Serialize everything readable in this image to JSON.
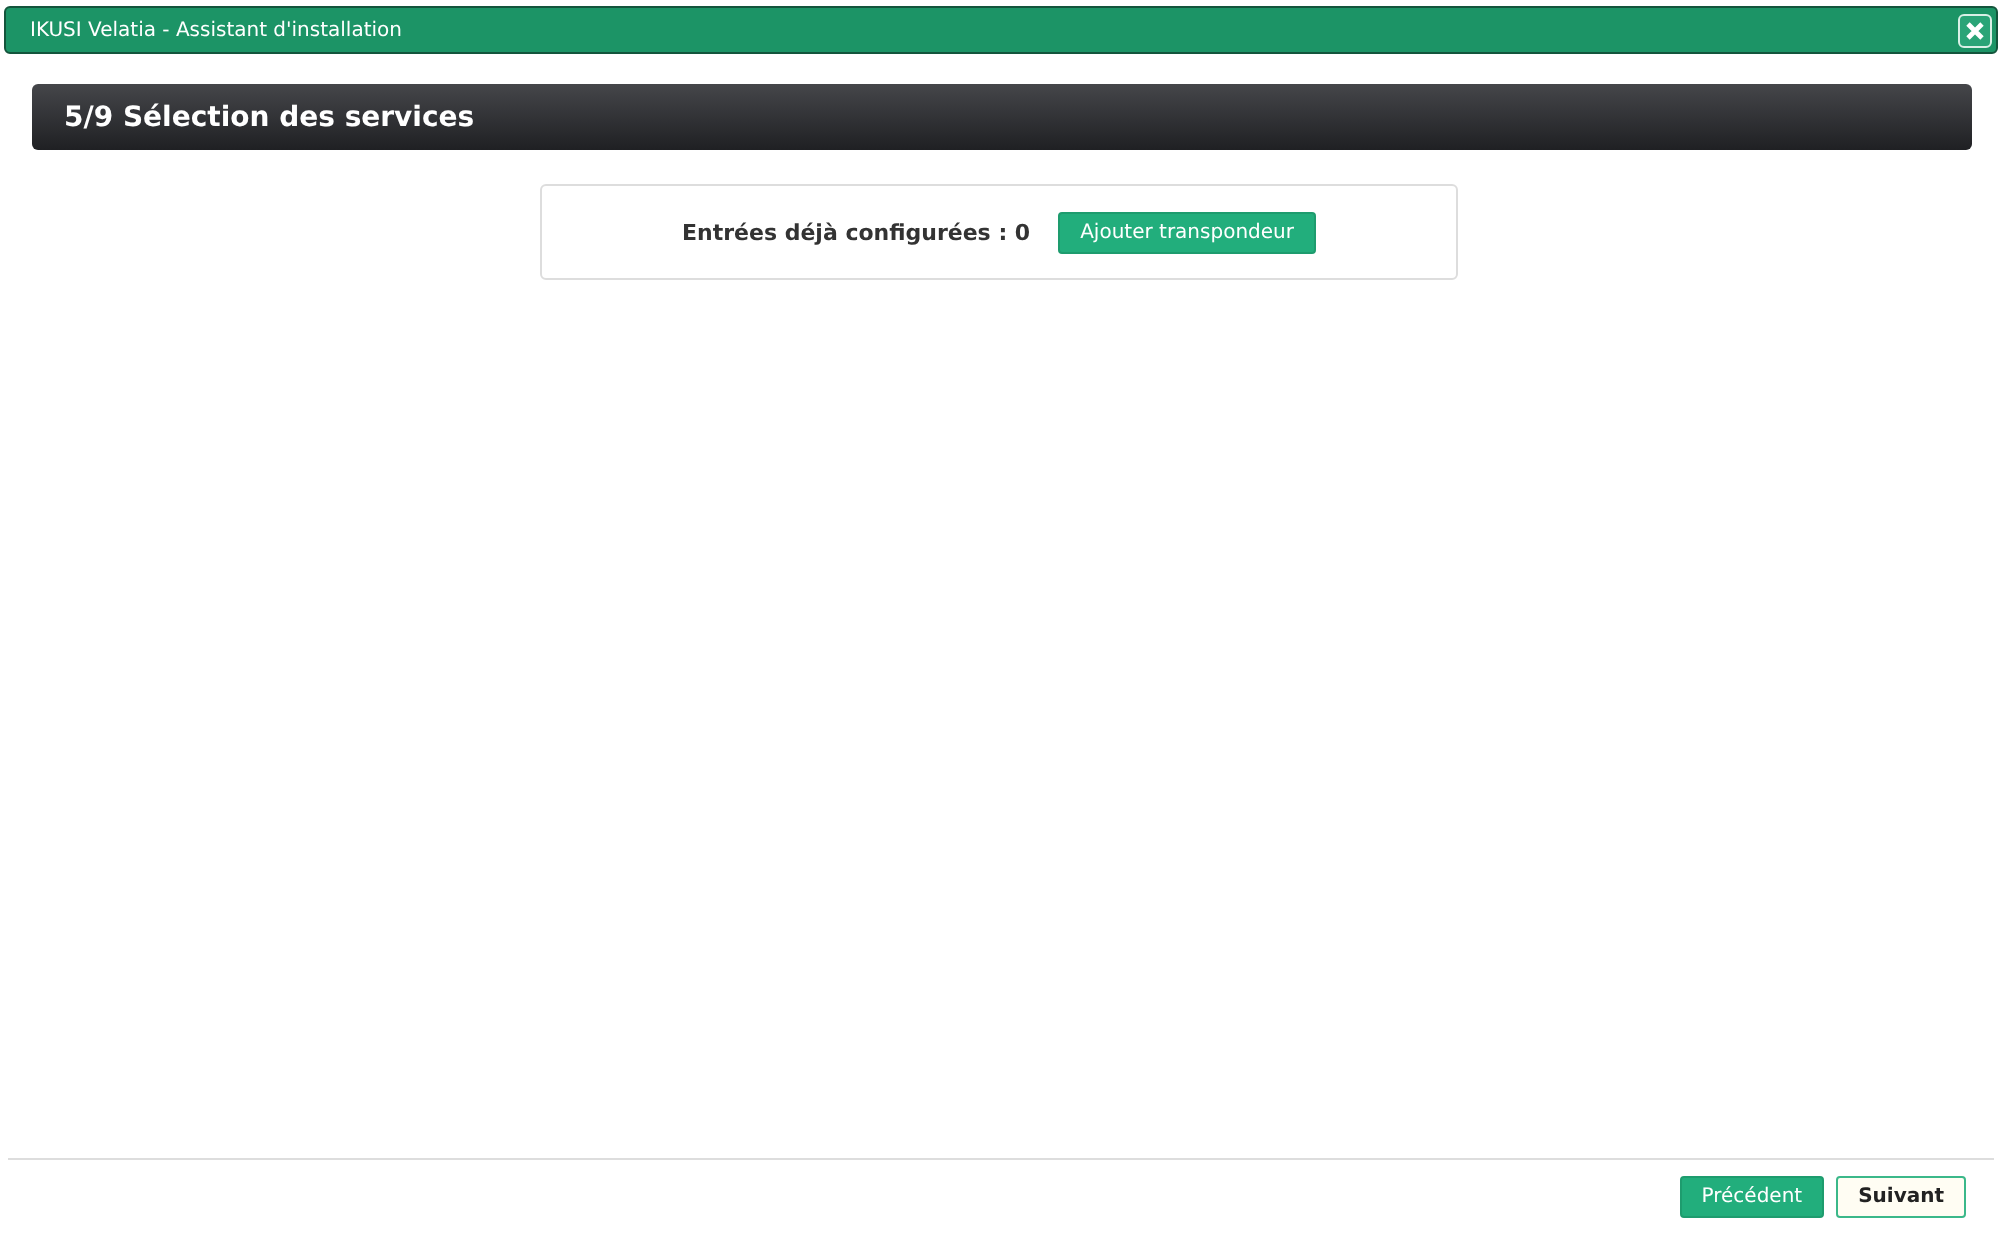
{
  "window": {
    "title": "IKUSI Velatia - Assistant d'installation"
  },
  "step": {
    "title": "5/9 Sélection des services"
  },
  "entries": {
    "label": "Entrées déjà configurées : 0",
    "button": "Ajouter transpondeur"
  },
  "footer": {
    "buttons": [
      {
        "label": "Précédent",
        "kind": "primary"
      },
      {
        "label": "Suivant",
        "kind": "secondary"
      }
    ]
  }
}
